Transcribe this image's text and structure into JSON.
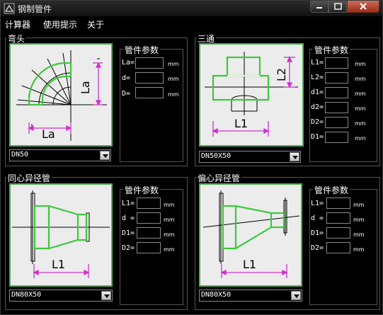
{
  "window": {
    "title": "钢制管件"
  },
  "menu": [
    "计算器",
    "使用提示",
    "关于"
  ],
  "panels": {
    "elbow": {
      "title": "弯头",
      "params_title": "管件参数",
      "params": [
        {
          "label": "La=",
          "unit": "mm"
        },
        {
          "label": "d=",
          "unit": "mm"
        },
        {
          "label": "D=",
          "unit": "mm"
        }
      ],
      "diagram_labels": {
        "la_h": "La",
        "la_v": "La"
      },
      "select_value": "DN50"
    },
    "tee": {
      "title": "三通",
      "params_title": "管件参数",
      "params": [
        {
          "label": "L1=",
          "unit": "mm"
        },
        {
          "label": "L2=",
          "unit": "mm"
        },
        {
          "label": "d1=",
          "unit": "mm"
        },
        {
          "label": "d2=",
          "unit": "mm"
        },
        {
          "label": "D2=",
          "unit": "mm"
        },
        {
          "label": "D1=",
          "unit": "mm"
        }
      ],
      "diagram_labels": {
        "l1": "L1",
        "l2": "L2"
      },
      "select_value": "DN50X50"
    },
    "concentric": {
      "title": "同心异径管",
      "params_title": "管件参数",
      "params": [
        {
          "label": "L1=",
          "unit": "mm"
        },
        {
          "label": "d =",
          "unit": "mm"
        },
        {
          "label": "D1=",
          "unit": "mm"
        },
        {
          "label": "D2=",
          "unit": "mm"
        }
      ],
      "diagram_labels": {
        "l1": "L1"
      },
      "select_value": "DN80X50"
    },
    "eccentric": {
      "title": "偏心异径管",
      "params_title": "管件参数",
      "params": [
        {
          "label": "L1=",
          "unit": "mm"
        },
        {
          "label": "d =",
          "unit": "mm"
        },
        {
          "label": "D1=",
          "unit": "mm"
        },
        {
          "label": "D2=",
          "unit": "mm"
        }
      ],
      "diagram_labels": {
        "l1": "L1"
      },
      "select_value": "DN80X50"
    }
  },
  "colors": {
    "pipe_green": "#3ec83e",
    "dim_magenta": "#cc33cc",
    "canvas_bg": "#ececec"
  },
  "icons": [
    "app-icon",
    "minimize-icon",
    "maximize-icon",
    "close-icon",
    "chevron-down-icon"
  ]
}
